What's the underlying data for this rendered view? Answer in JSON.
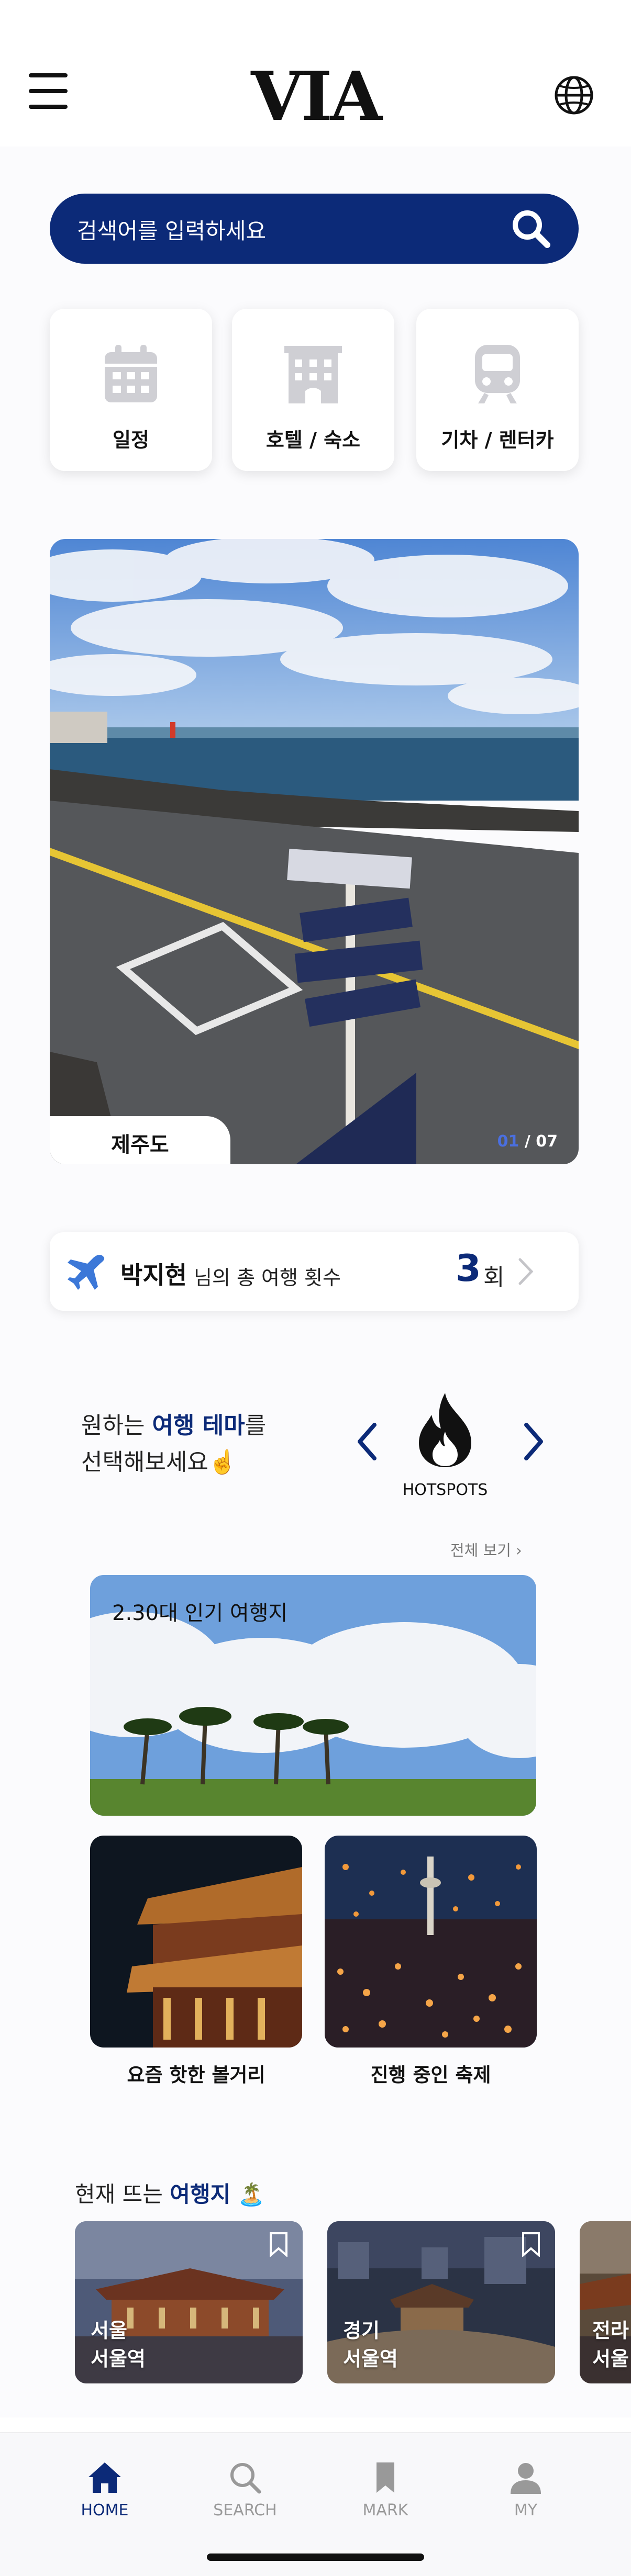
{
  "header": {
    "logo": "VIA",
    "menu_icon": "hamburger-menu-icon",
    "language_icon": "globe-icon"
  },
  "search": {
    "placeholder": "검색어를 입력하세요",
    "icon": "search-icon"
  },
  "categories": [
    {
      "label": "일정",
      "icon": "calendar-icon"
    },
    {
      "label": "호텔 / 숙소",
      "icon": "hotel-icon"
    },
    {
      "label": "기차 / 렌터카",
      "icon": "train-icon"
    }
  ],
  "hero": {
    "location": "제주도",
    "page_current": "01",
    "page_total": " / 07"
  },
  "trip": {
    "name": "박지현",
    "suffix": "님의 총 여행 횟수",
    "count": "3",
    "unit": "회"
  },
  "theme": {
    "prompt_prefix": "원하는 ",
    "prompt_highlight": "여행 테마",
    "prompt_suffix": "를",
    "prompt_line2": "선택해보세요☝️",
    "current_theme": "HOTSPOTS",
    "see_all": "전체 보기",
    "big_card_title": "2.30대 인기 여행지",
    "small_cards": [
      {
        "label": "요즘 핫한 볼거리"
      },
      {
        "label": "진행 중인 축제"
      }
    ]
  },
  "trending": {
    "title_prefix": "현재 뜨는 ",
    "title_highlight": "여행지",
    "title_emoji": "🏝️",
    "cards": [
      {
        "line1": "서울",
        "line2": "서울역"
      },
      {
        "line1": "경기",
        "line2": "서울역"
      },
      {
        "line1": "전라",
        "line2": "서울"
      }
    ]
  },
  "nav": [
    {
      "label": "HOME",
      "icon": "home-icon",
      "active": true
    },
    {
      "label": "SEARCH",
      "icon": "search-icon",
      "active": false
    },
    {
      "label": "MARK",
      "icon": "bookmark-icon",
      "active": false
    },
    {
      "label": "MY",
      "icon": "user-icon",
      "active": false
    }
  ],
  "colors": {
    "primary": "#0c2a78",
    "background": "#fbfbfd",
    "card_icon": "#cfcfd4"
  }
}
